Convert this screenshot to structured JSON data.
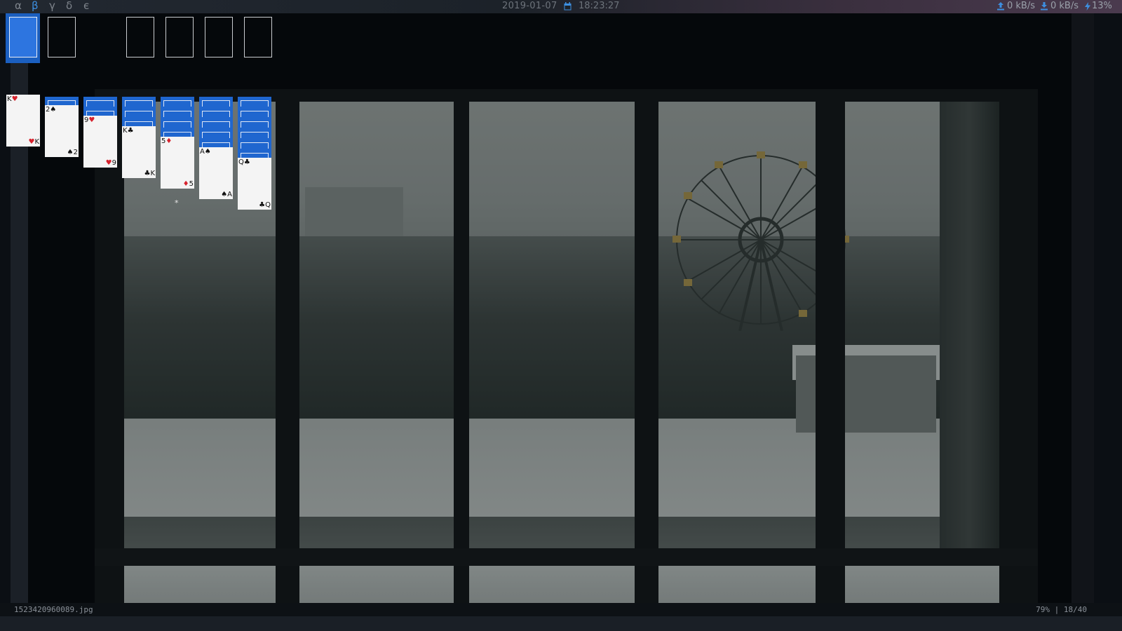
{
  "topbar": {
    "workspaces": [
      "α",
      "β",
      "γ",
      "δ",
      "є"
    ],
    "active_workspace": "β",
    "date": "2019-01-07",
    "time": "18:23:27",
    "upload": "0 kB/s",
    "download": "0 kB/s",
    "battery": "13%"
  },
  "solitaire": {
    "columns": [
      {
        "face_down": 0,
        "card": {
          "rank": "K",
          "suit": "♥",
          "color": "red"
        }
      },
      {
        "face_down": 1,
        "card": {
          "rank": "2",
          "suit": "♠",
          "color": "black"
        }
      },
      {
        "face_down": 2,
        "card": {
          "rank": "9",
          "suit": "♥",
          "color": "red"
        }
      },
      {
        "face_down": 3,
        "card": {
          "rank": "K",
          "suit": "♣",
          "color": "black"
        }
      },
      {
        "face_down": 4,
        "card": {
          "rank": "5",
          "suit": "♦",
          "color": "red"
        }
      },
      {
        "face_down": 5,
        "card": {
          "rank": "A",
          "suit": "♠",
          "color": "black"
        }
      },
      {
        "face_down": 6,
        "card": {
          "rank": "Q",
          "suit": "♣",
          "color": "black"
        }
      }
    ],
    "cursor": "*"
  },
  "viewer": {
    "filename": "1523420960089.jpg",
    "zoom": "79%",
    "position": "18/40"
  },
  "colors": {
    "accent": "#3d8fe0",
    "card_back": "#1f66cf"
  }
}
